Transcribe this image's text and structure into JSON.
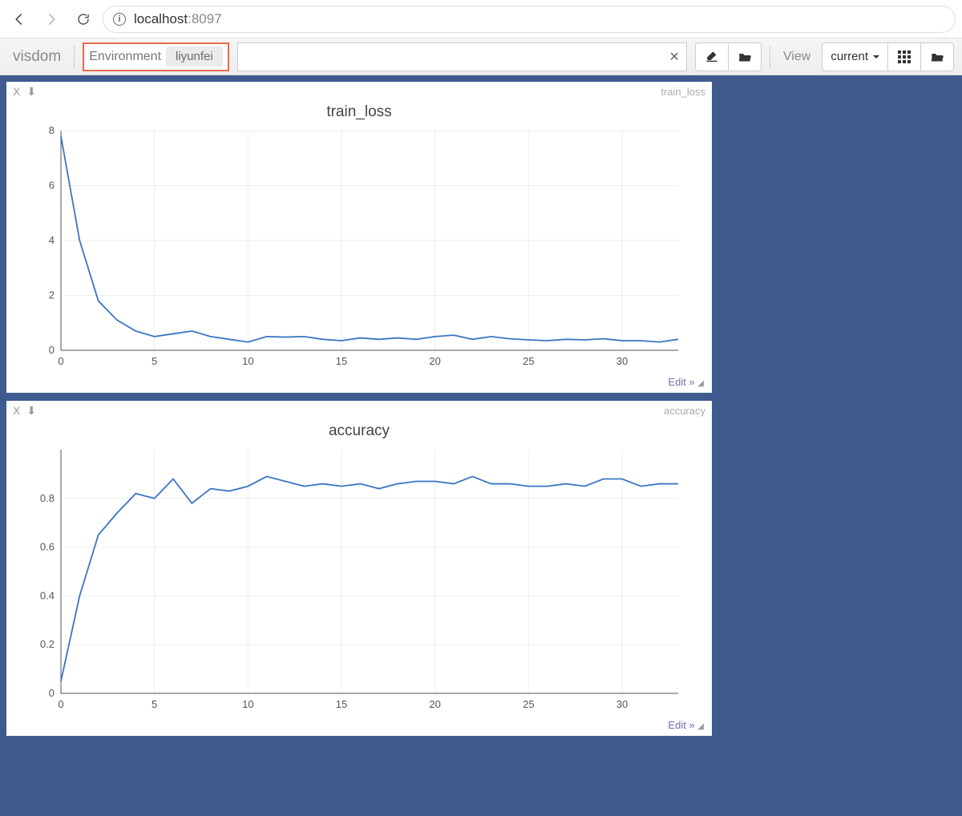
{
  "browser": {
    "url_text": "localhost:8097",
    "url_host": "localhost",
    "url_port": ":8097"
  },
  "toolbar": {
    "brand": "visdom",
    "env_label": "Environment",
    "env_chip": "liyunfei",
    "view_label": "View",
    "view_select": "current"
  },
  "panes": [
    {
      "close": "X",
      "download": "⬇",
      "mini": "train_loss",
      "title": "train_loss",
      "edit": "Edit »"
    },
    {
      "close": "X",
      "download": "⬇",
      "mini": "accuracy",
      "title": "accuracy",
      "edit": "Edit »"
    }
  ],
  "chart_data": [
    {
      "type": "line",
      "title": "train_loss",
      "xlabel": "",
      "ylabel": "",
      "xlim": [
        0,
        33
      ],
      "ylim": [
        0,
        8
      ],
      "xticks": [
        0,
        5,
        10,
        15,
        20,
        25,
        30
      ],
      "yticks": [
        0,
        2,
        4,
        6,
        8
      ],
      "series": [
        {
          "name": "train_loss",
          "x": [
            0,
            1,
            2,
            3,
            4,
            5,
            6,
            7,
            8,
            9,
            10,
            11,
            12,
            13,
            14,
            15,
            16,
            17,
            18,
            19,
            20,
            21,
            22,
            23,
            24,
            25,
            26,
            27,
            28,
            29,
            30,
            31,
            32,
            33
          ],
          "values": [
            7.8,
            4.0,
            1.8,
            1.1,
            0.7,
            0.5,
            0.6,
            0.7,
            0.5,
            0.4,
            0.3,
            0.5,
            0.48,
            0.5,
            0.4,
            0.35,
            0.45,
            0.4,
            0.45,
            0.4,
            0.5,
            0.55,
            0.4,
            0.5,
            0.42,
            0.38,
            0.35,
            0.4,
            0.38,
            0.42,
            0.35,
            0.35,
            0.3,
            0.4
          ]
        }
      ]
    },
    {
      "type": "line",
      "title": "accuracy",
      "xlabel": "",
      "ylabel": "",
      "xlim": [
        0,
        33
      ],
      "ylim": [
        0,
        1
      ],
      "xticks": [
        0,
        5,
        10,
        15,
        20,
        25,
        30
      ],
      "yticks": [
        0,
        0.2,
        0.4,
        0.6,
        0.8
      ],
      "series": [
        {
          "name": "accuracy",
          "x": [
            0,
            1,
            2,
            3,
            4,
            5,
            6,
            7,
            8,
            9,
            10,
            11,
            12,
            13,
            14,
            15,
            16,
            17,
            18,
            19,
            20,
            21,
            22,
            23,
            24,
            25,
            26,
            27,
            28,
            29,
            30,
            31,
            32,
            33
          ],
          "values": [
            0.05,
            0.4,
            0.65,
            0.74,
            0.82,
            0.8,
            0.88,
            0.78,
            0.84,
            0.83,
            0.85,
            0.89,
            0.87,
            0.85,
            0.86,
            0.85,
            0.86,
            0.84,
            0.86,
            0.87,
            0.87,
            0.86,
            0.89,
            0.86,
            0.86,
            0.85,
            0.85,
            0.86,
            0.85,
            0.88,
            0.88,
            0.85,
            0.86,
            0.86
          ]
        }
      ]
    }
  ]
}
